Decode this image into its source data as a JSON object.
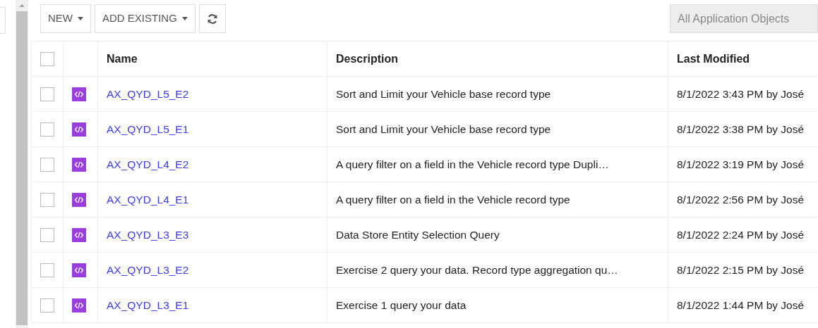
{
  "toolbar": {
    "buttons": [
      {
        "label": "NEW",
        "dropdown": true
      },
      {
        "label": "ADD EXISTING",
        "dropdown": true
      }
    ],
    "filter": {
      "placeholder": "All Application Objects"
    }
  },
  "table": {
    "header_checkbox": {
      "checked": false
    },
    "columns": [
      "Name",
      "Description",
      "Last Modified"
    ],
    "rows": [
      {
        "checked": false,
        "name": "AX_QYD_L5_E2",
        "description": "Sort and Limit your Vehicle base record type",
        "last_modified": "8/1/2022 3:43 PM by José"
      },
      {
        "checked": false,
        "name": "AX_QYD_L5_E1",
        "description": "Sort and Limit your Vehicle base record type",
        "last_modified": "8/1/2022 3:38 PM by José"
      },
      {
        "checked": false,
        "name": "AX_QYD_L4_E2",
        "description": "A query filter on a field in the Vehicle record type Dupli…",
        "last_modified": "8/1/2022 3:19 PM by José"
      },
      {
        "checked": false,
        "name": "AX_QYD_L4_E1",
        "description": "A query filter on a field in the Vehicle record type",
        "last_modified": "8/1/2022 2:56 PM by José"
      },
      {
        "checked": false,
        "name": "AX_QYD_L3_E3",
        "description": "Data Store Entity Selection Query",
        "last_modified": "8/1/2022 2:24 PM by José"
      },
      {
        "checked": false,
        "name": "AX_QYD_L3_E2",
        "description": "Exercise 2 query your data. Record type aggregation qu…",
        "last_modified": "8/1/2022 2:15 PM by José"
      },
      {
        "checked": false,
        "name": "AX_QYD_L3_E1",
        "description": "Exercise 1 query your data",
        "last_modified": "8/1/2022 1:44 PM by José"
      }
    ]
  }
}
